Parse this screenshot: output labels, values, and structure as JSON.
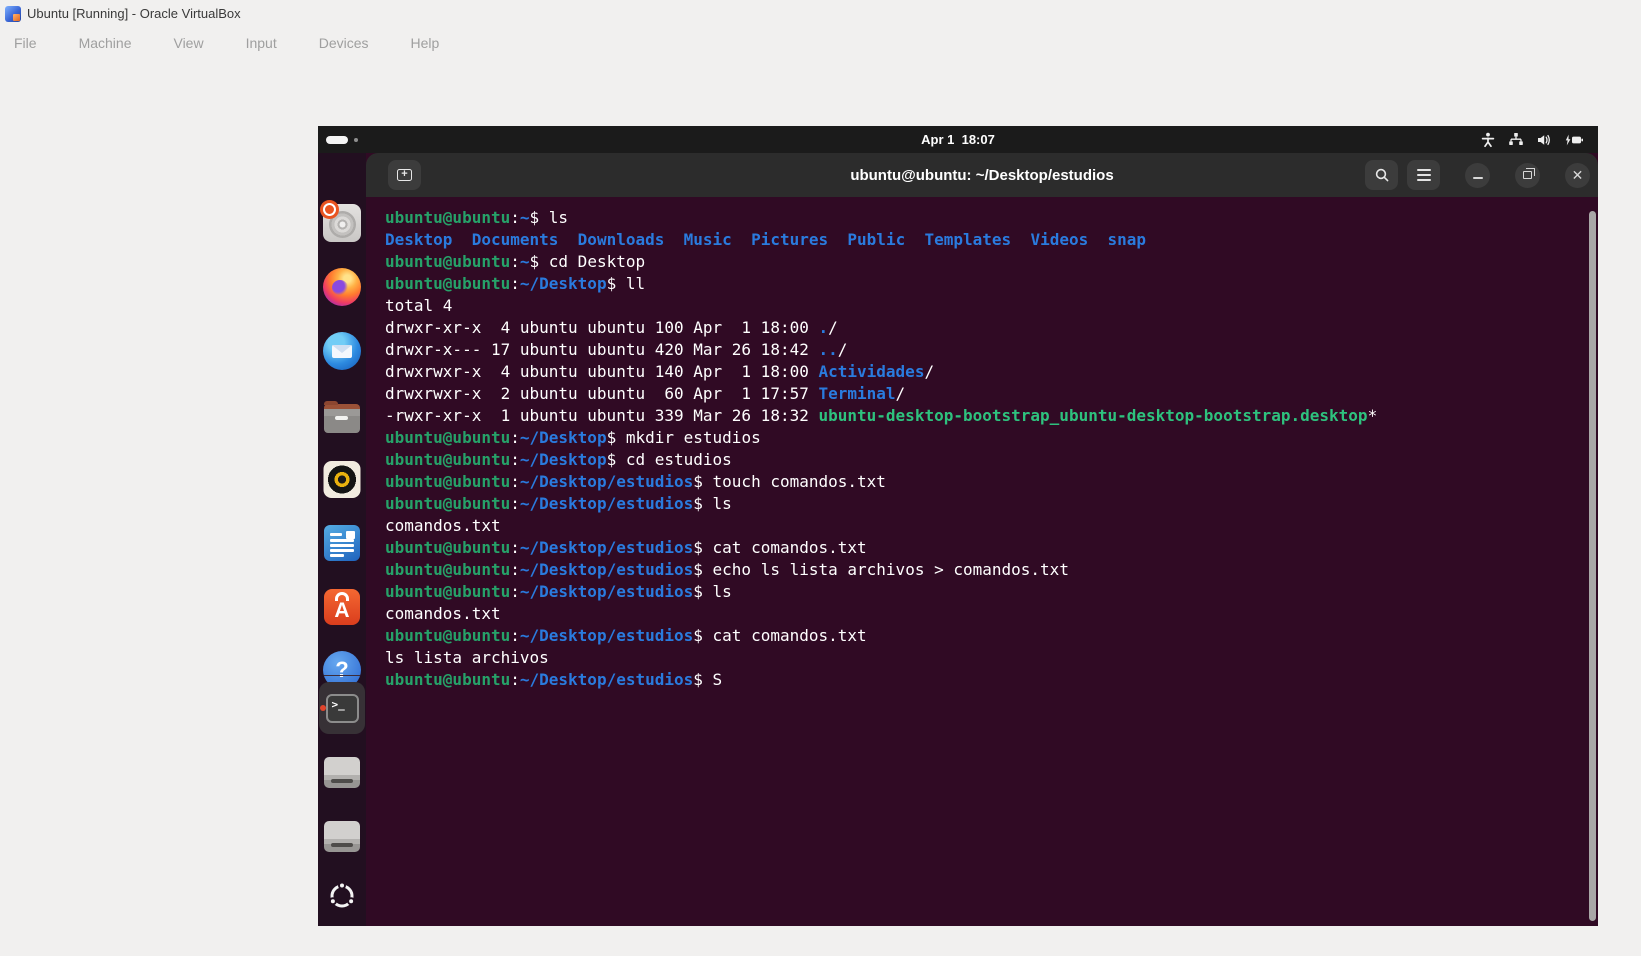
{
  "titlebar": {
    "title": "Ubuntu [Running] - Oracle VirtualBox"
  },
  "menubar": {
    "items": [
      "File",
      "Machine",
      "View",
      "Input",
      "Devices",
      "Help"
    ]
  },
  "vm_topbar": {
    "clock": "Apr 1  18:07",
    "tray_icons": [
      "accessibility-icon",
      "network-icon",
      "volume-icon",
      "battery-icon"
    ],
    "workspace_indicator": "pill-plus-dot"
  },
  "dock": {
    "items": [
      {
        "name": "ubuntu-installer"
      },
      {
        "name": "firefox"
      },
      {
        "name": "thunderbird"
      },
      {
        "name": "files"
      },
      {
        "name": "rhythmbox"
      },
      {
        "name": "libreoffice-writer"
      },
      {
        "name": "app-center"
      },
      {
        "name": "help"
      },
      {
        "name": "terminal",
        "active": true,
        "running_indicator": "#e0442c"
      },
      {
        "name": "removable-drive-1"
      },
      {
        "name": "removable-drive-2"
      },
      {
        "name": "show-apps"
      }
    ]
  },
  "terminal": {
    "title": "ubuntu@ubuntu: ~/Desktop/estudios",
    "header_buttons": [
      "new-tab",
      "search",
      "menu",
      "minimize",
      "restore",
      "close"
    ],
    "colors": {
      "background": "#300a24",
      "header": "#2c2c2c",
      "user_host_green": "#26a269",
      "path_blue": "#2a7bde",
      "executable_green": "#2ec27e",
      "foreground": "#ffffff"
    },
    "lines": [
      [
        {
          "t": "ubuntu@ubuntu",
          "c": "user"
        },
        {
          "t": ":",
          "c": "fg"
        },
        {
          "t": "~",
          "c": "path"
        },
        {
          "t": "$ ",
          "c": "fg"
        },
        {
          "t": "ls",
          "c": "fg"
        }
      ],
      [
        {
          "t": "Desktop",
          "c": "dir"
        },
        {
          "t": "  ",
          "c": "fg"
        },
        {
          "t": "Documents",
          "c": "dir"
        },
        {
          "t": "  ",
          "c": "fg"
        },
        {
          "t": "Downloads",
          "c": "dir"
        },
        {
          "t": "  ",
          "c": "fg"
        },
        {
          "t": "Music",
          "c": "dir"
        },
        {
          "t": "  ",
          "c": "fg"
        },
        {
          "t": "Pictures",
          "c": "dir"
        },
        {
          "t": "  ",
          "c": "fg"
        },
        {
          "t": "Public",
          "c": "dir"
        },
        {
          "t": "  ",
          "c": "fg"
        },
        {
          "t": "Templates",
          "c": "dir"
        },
        {
          "t": "  ",
          "c": "fg"
        },
        {
          "t": "Videos",
          "c": "dir"
        },
        {
          "t": "  ",
          "c": "fg"
        },
        {
          "t": "snap",
          "c": "dir"
        }
      ],
      [
        {
          "t": "ubuntu@ubuntu",
          "c": "user"
        },
        {
          "t": ":",
          "c": "fg"
        },
        {
          "t": "~",
          "c": "path"
        },
        {
          "t": "$ ",
          "c": "fg"
        },
        {
          "t": "cd Desktop",
          "c": "fg"
        }
      ],
      [
        {
          "t": "ubuntu@ubuntu",
          "c": "user"
        },
        {
          "t": ":",
          "c": "fg"
        },
        {
          "t": "~/Desktop",
          "c": "path"
        },
        {
          "t": "$ ",
          "c": "fg"
        },
        {
          "t": "ll",
          "c": "fg"
        }
      ],
      [
        {
          "t": "total 4",
          "c": "fg"
        }
      ],
      [
        {
          "t": "drwxr-xr-x  4 ubuntu ubuntu 100 Apr  1 18:00 ",
          "c": "fg"
        },
        {
          "t": ".",
          "c": "dir"
        },
        {
          "t": "/",
          "c": "fg"
        }
      ],
      [
        {
          "t": "drwxr-x--- 17 ubuntu ubuntu 420 Mar 26 18:42 ",
          "c": "fg"
        },
        {
          "t": "..",
          "c": "dir"
        },
        {
          "t": "/",
          "c": "fg"
        }
      ],
      [
        {
          "t": "drwxrwxr-x  4 ubuntu ubuntu 140 Apr  1 18:00 ",
          "c": "fg"
        },
        {
          "t": "Actividades",
          "c": "dir"
        },
        {
          "t": "/",
          "c": "fg"
        }
      ],
      [
        {
          "t": "drwxrwxr-x  2 ubuntu ubuntu  60 Apr  1 17:57 ",
          "c": "fg"
        },
        {
          "t": "Terminal",
          "c": "dir"
        },
        {
          "t": "/",
          "c": "fg"
        }
      ],
      [
        {
          "t": "-rwxr-xr-x  1 ubuntu ubuntu 339 Mar 26 18:32 ",
          "c": "fg"
        },
        {
          "t": "ubuntu-desktop-bootstrap_ubuntu-desktop-bootstrap.desktop",
          "c": "exec"
        },
        {
          "t": "*",
          "c": "fg"
        }
      ],
      [
        {
          "t": "ubuntu@ubuntu",
          "c": "user"
        },
        {
          "t": ":",
          "c": "fg"
        },
        {
          "t": "~/Desktop",
          "c": "path"
        },
        {
          "t": "$ ",
          "c": "fg"
        },
        {
          "t": "mkdir estudios",
          "c": "fg"
        }
      ],
      [
        {
          "t": "ubuntu@ubuntu",
          "c": "user"
        },
        {
          "t": ":",
          "c": "fg"
        },
        {
          "t": "~/Desktop",
          "c": "path"
        },
        {
          "t": "$ ",
          "c": "fg"
        },
        {
          "t": "cd estudios",
          "c": "fg"
        }
      ],
      [
        {
          "t": "ubuntu@ubuntu",
          "c": "user"
        },
        {
          "t": ":",
          "c": "fg"
        },
        {
          "t": "~/Desktop/estudios",
          "c": "path"
        },
        {
          "t": "$ ",
          "c": "fg"
        },
        {
          "t": "touch comandos.txt",
          "c": "fg"
        }
      ],
      [
        {
          "t": "ubuntu@ubuntu",
          "c": "user"
        },
        {
          "t": ":",
          "c": "fg"
        },
        {
          "t": "~/Desktop/estudios",
          "c": "path"
        },
        {
          "t": "$ ",
          "c": "fg"
        },
        {
          "t": "ls",
          "c": "fg"
        }
      ],
      [
        {
          "t": "comandos.txt",
          "c": "fg"
        }
      ],
      [
        {
          "t": "ubuntu@ubuntu",
          "c": "user"
        },
        {
          "t": ":",
          "c": "fg"
        },
        {
          "t": "~/Desktop/estudios",
          "c": "path"
        },
        {
          "t": "$ ",
          "c": "fg"
        },
        {
          "t": "cat comandos.txt",
          "c": "fg"
        }
      ],
      [
        {
          "t": "ubuntu@ubuntu",
          "c": "user"
        },
        {
          "t": ":",
          "c": "fg"
        },
        {
          "t": "~/Desktop/estudios",
          "c": "path"
        },
        {
          "t": "$ ",
          "c": "fg"
        },
        {
          "t": "echo ls lista archivos > comandos.txt",
          "c": "fg"
        }
      ],
      [
        {
          "t": "ubuntu@ubuntu",
          "c": "user"
        },
        {
          "t": ":",
          "c": "fg"
        },
        {
          "t": "~/Desktop/estudios",
          "c": "path"
        },
        {
          "t": "$ ",
          "c": "fg"
        },
        {
          "t": "ls",
          "c": "fg"
        }
      ],
      [
        {
          "t": "comandos.txt",
          "c": "fg"
        }
      ],
      [
        {
          "t": "ubuntu@ubuntu",
          "c": "user"
        },
        {
          "t": ":",
          "c": "fg"
        },
        {
          "t": "~/Desktop/estudios",
          "c": "path"
        },
        {
          "t": "$ ",
          "c": "fg"
        },
        {
          "t": "cat comandos.txt",
          "c": "fg"
        }
      ],
      [
        {
          "t": "ls lista archivos",
          "c": "fg"
        }
      ],
      [
        {
          "t": "ubuntu@ubuntu",
          "c": "user"
        },
        {
          "t": ":",
          "c": "fg"
        },
        {
          "t": "~/Desktop/estudios",
          "c": "path"
        },
        {
          "t": "$ ",
          "c": "fg"
        },
        {
          "t": "S",
          "c": "fg"
        }
      ]
    ]
  }
}
